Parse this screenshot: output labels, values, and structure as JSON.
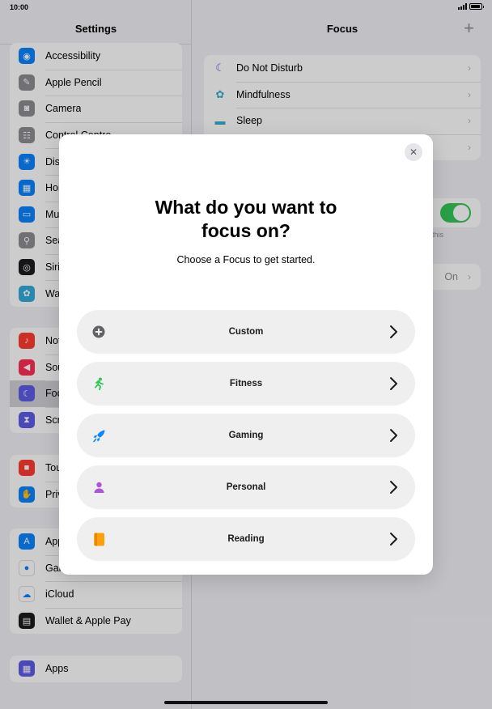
{
  "status": {
    "time": "10:00",
    "battery_level": 0.9
  },
  "sidebar": {
    "title": "Settings",
    "group1": [
      {
        "label": "Accessibility",
        "icon": "accessibility-icon",
        "color": "#0a84ff",
        "glyph": "◉"
      },
      {
        "label": "Apple Pencil",
        "icon": "pencil-icon",
        "color": "#8e8e93",
        "glyph": "✎"
      },
      {
        "label": "Camera",
        "icon": "camera-icon",
        "color": "#8e8e93",
        "glyph": "◙"
      },
      {
        "label": "Control Centre",
        "icon": "control-centre-icon",
        "color": "#8e8e93",
        "glyph": "☷"
      },
      {
        "label": "Display & Brightness",
        "icon": "brightness-icon",
        "color": "#0a84ff",
        "glyph": "☀"
      },
      {
        "label": "Home Screen",
        "icon": "home-screen-icon",
        "color": "#0a84ff",
        "glyph": "▦"
      },
      {
        "label": "Multitasking",
        "icon": "multitasking-icon",
        "color": "#0a84ff",
        "glyph": "▭"
      },
      {
        "label": "Search",
        "icon": "search-icon",
        "color": "#8e8e93",
        "glyph": "⚲"
      },
      {
        "label": "Siri",
        "icon": "siri-icon",
        "color": "#1c1c1e",
        "glyph": "◎"
      },
      {
        "label": "Wallpaper",
        "icon": "wallpaper-icon",
        "color": "#34aadc",
        "glyph": "✿"
      }
    ],
    "group2": [
      {
        "label": "Notifications",
        "icon": "notifications-icon",
        "color": "#ff3b30",
        "glyph": "♪"
      },
      {
        "label": "Sounds",
        "icon": "sounds-icon",
        "color": "#ff2d55",
        "glyph": "◀"
      },
      {
        "label": "Focus",
        "icon": "focus-moon-icon",
        "color": "#5e5ce6",
        "glyph": "☾"
      },
      {
        "label": "Screen Time",
        "icon": "screen-time-icon",
        "color": "#5e5ce6",
        "glyph": "⧗"
      }
    ],
    "group3": [
      {
        "label": "Touch ID & Passcode",
        "icon": "lock-icon",
        "color": "#ff3b30",
        "glyph": "■"
      },
      {
        "label": "Privacy & Security",
        "icon": "privacy-hand-icon",
        "color": "#0a84ff",
        "glyph": "✋"
      }
    ],
    "group4": [
      {
        "label": "App Store",
        "icon": "app-store-icon",
        "color": "#0a84ff",
        "glyph": "A"
      },
      {
        "label": "Game Center",
        "icon": "game-center-icon",
        "color": "#ffffff",
        "glyph": "●"
      },
      {
        "label": "iCloud",
        "icon": "icloud-icon",
        "color": "#ffffff",
        "glyph": "☁"
      },
      {
        "label": "Wallet & Apple Pay",
        "icon": "wallet-icon",
        "color": "#1c1c1e",
        "glyph": "▤"
      }
    ],
    "group5": [
      {
        "label": "Apps",
        "icon": "apps-grid-icon",
        "color": "#5e5ce6",
        "glyph": "▦"
      }
    ]
  },
  "detail": {
    "title": "Focus",
    "add_symbol": "+",
    "focus_items": [
      {
        "label": "Do Not Disturb",
        "icon": "moon-icon",
        "color": "#5e5ce6",
        "glyph": "☾"
      },
      {
        "label": "Mindfulness",
        "icon": "mindfulness-flower-icon",
        "color": "#30b0c7",
        "glyph": "✿"
      },
      {
        "label": "Sleep",
        "icon": "sleep-bed-icon",
        "color": "#30b0c7",
        "glyph": "▬"
      },
      {
        "label": "",
        "icon": "",
        "color": "#ffffff",
        "glyph": ""
      }
    ],
    "toggle_on": true,
    "toggle_note": "this",
    "on_value": "On"
  },
  "modal": {
    "title_line1": "What do you want to",
    "title_line2": "focus on?",
    "subtitle": "Choose a Focus to get started.",
    "options": [
      {
        "label": "Custom",
        "icon": "plus-circle-icon",
        "color": "#636366"
      },
      {
        "label": "Fitness",
        "icon": "running-figure-icon",
        "color": "#34c759"
      },
      {
        "label": "Gaming",
        "icon": "rocket-icon",
        "color": "#0a84ff"
      },
      {
        "label": "Personal",
        "icon": "person-icon",
        "color": "#af52de"
      },
      {
        "label": "Reading",
        "icon": "book-icon",
        "color": "#ff9f0a"
      }
    ]
  }
}
